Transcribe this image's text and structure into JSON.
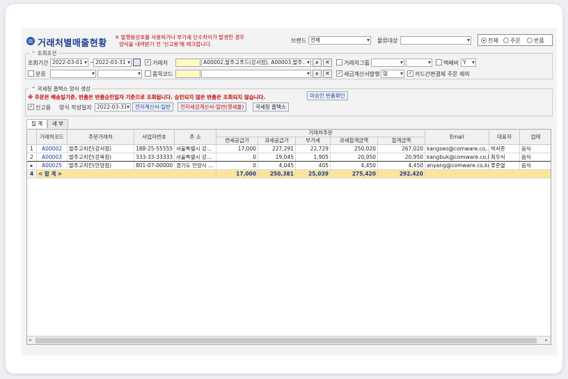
{
  "title": "거래처별매출현황",
  "warning_lines": [
    "발행용상호를 사용하거나 부가세 단수차이가 발생한 경우",
    "양식을 내려받기 전 '신고용'에 체크합니다."
  ],
  "top": {
    "brand_label": "브랜드",
    "brand_value": "전체",
    "logistics_label": "물류대상",
    "logistics_value": "",
    "radios": [
      {
        "label": "전체",
        "on": true
      },
      {
        "label": "주문",
        "on": false
      },
      {
        "label": "반품",
        "on": false
      }
    ]
  },
  "filters": {
    "group_title": "조회조건",
    "period_label": "조회기간",
    "date_from": "2022-03-01",
    "date_to": "2022-03-31",
    "client_label": "거래처",
    "client_value": "A00002,발주고푸드(강서점), A00003,발주...",
    "client_group_label": "거래처그룹",
    "collect_label": "택배비",
    "collect_value": "Y",
    "category_label": "분류",
    "item_code_label": "품목코드",
    "tax_invoice_label": "세금계산서발행",
    "tax_invoice_value": "않",
    "card_label": "카드간편결제 주문 제외"
  },
  "hometax": {
    "group_title": "국세청 홈택스 양식 생성",
    "notice": "※ 주문은 배송일기준, 반품은 반품승인일자 기준으로 조회됩니다. 승인되지 않은 반품은 조회되지 않습니다.",
    "unapproved_button": "미승인 반품확인",
    "report_label": "신고용",
    "date_label": "양식 작성일자",
    "date_value": "2022-03-31",
    "btn_general": "전자계산서-일반",
    "btn_tax": "전자세금계산서-일반(영세율)",
    "btn_hometax": "국세청 홈택스"
  },
  "tabs": [
    "집 계",
    "세 부"
  ],
  "table": {
    "group_header": "거래처주문",
    "headers": [
      "거래처코드",
      "주문거래처",
      "사업자번호",
      "주 소",
      "면세공급가",
      "과세공급가",
      "부가세",
      "과세합계금액",
      "합계금액",
      "Email",
      "대표자",
      "업태"
    ],
    "rows": [
      {
        "no": "1",
        "code": "A00002",
        "name": "발주고치킨(강서점)",
        "biz": "188-25-55555",
        "addr": "서울특별시 강...",
        "free": "17,000",
        "taxable": "227,291",
        "vat": "22,729",
        "taxsum": "250,020",
        "total": "267,020",
        "email": "kangseo@comware.co,...",
        "rep": "박서준",
        "type": "음식"
      },
      {
        "no": "2",
        "code": "A00003",
        "name": "발주고치킨(강북점)",
        "biz": "333-33-33333",
        "addr": "서울특별시 강...",
        "free": "0",
        "taxable": "19,045",
        "vat": "1,905",
        "taxsum": "20,950",
        "total": "20,950",
        "email": "kangbuk@comware.co,kr",
        "rep": "최우식",
        "type": "음식"
      },
      {
        "no": "▸",
        "code": "A00025",
        "name": "발주고치킨(안양점)",
        "biz": "801-07-00000",
        "addr": "경기도 안양시 ...",
        "free": "0",
        "taxable": "4,045",
        "vat": "405",
        "taxsum": "4,450",
        "total": "4,450",
        "email": "anyang@comware.co,kr",
        "rep": "류준열",
        "type": "음식"
      }
    ],
    "sum": {
      "no": "4",
      "label": "< 합 계 >",
      "free": "17,000",
      "taxable": "250,381",
      "vat": "25,039",
      "taxsum": "275,420",
      "total": "292,420"
    }
  }
}
